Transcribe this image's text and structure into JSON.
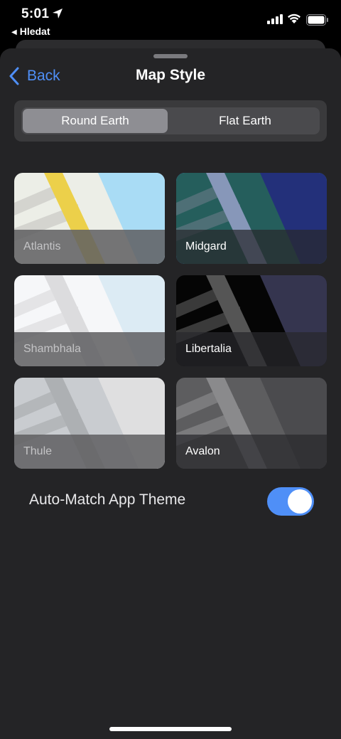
{
  "status_bar": {
    "time": "5:01",
    "back_app": "Hledat"
  },
  "nav": {
    "back_label": "Back",
    "title": "Map Style"
  },
  "segment": {
    "options": [
      "Round Earth",
      "Flat Earth"
    ],
    "selected_index": 0
  },
  "styles": [
    {
      "name": "Atlantis",
      "selected": false,
      "colors": {
        "bg": "#eceee7",
        "road": "#d4d4cf",
        "main_road": "#ecd04a",
        "water": "#a9dcf5"
      }
    },
    {
      "name": "Midgard",
      "selected": true,
      "colors": {
        "bg": "#255e5c",
        "road": "#4e6f76",
        "main_road": "#8797b9",
        "water": "#23307a"
      }
    },
    {
      "name": "Shambhala",
      "selected": false,
      "colors": {
        "bg": "#f6f7f9",
        "road": "#e4e4e6",
        "main_road": "#dcdcde",
        "water": "#dcebf4"
      }
    },
    {
      "name": "Libertalia",
      "selected": false,
      "colors": {
        "bg": "#050505",
        "road": "#3a3a3a",
        "main_road": "#555555",
        "water": "#35354f"
      }
    },
    {
      "name": "Thule",
      "selected": false,
      "colors": {
        "bg": "#c9ccd0",
        "road": "#b4b7ba",
        "main_road": "#adb0b3",
        "water": "#dfdfe0"
      }
    },
    {
      "name": "Avalon",
      "selected": false,
      "colors": {
        "bg": "#5d5d5f",
        "road": "#7b7b7d",
        "main_road": "#8a8a8c",
        "water": "#4b4b4e"
      }
    }
  ],
  "auto_match": {
    "label": "Auto-Match App Theme",
    "enabled": true
  },
  "accent_color": "#4f8ff7"
}
